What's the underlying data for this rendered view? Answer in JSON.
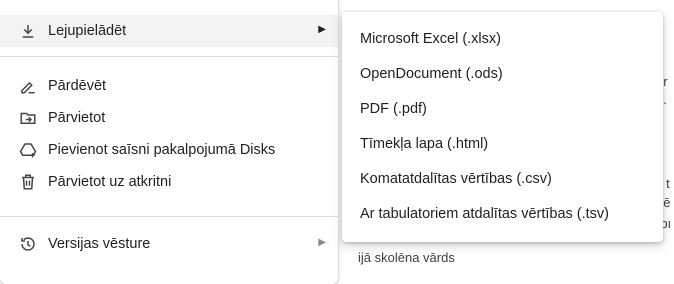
{
  "file_menu": {
    "download": {
      "label": "Lejupielādēt",
      "icon": "download-icon"
    },
    "rename": {
      "label": "Pārdēvēt",
      "icon": "rename-icon"
    },
    "move": {
      "label": "Pārvietot",
      "icon": "move-folder-icon"
    },
    "add_shortcut": {
      "label": "Pievienot saīsni pakalpojumā Disks",
      "icon": "add-shortcut-drive-icon"
    },
    "trash": {
      "label": "Pārvietot uz atkritni",
      "icon": "trash-icon"
    },
    "version_history": {
      "label": "Versijas vēsture",
      "icon": "history-icon"
    }
  },
  "download_submenu": {
    "items": [
      {
        "label": "Microsoft Excel (.xlsx)"
      },
      {
        "label": "OpenDocument (.ods)"
      },
      {
        "label": "PDF (.pdf)"
      },
      {
        "label": "Tīmekļa lapa (.html)"
      },
      {
        "label": "Komatatdalītas vērtības (.csv)"
      },
      {
        "label": "Ar tabulatoriem atdalītas vērtības (.tsv)"
      }
    ]
  },
  "background_fragments": [
    "or",
    "ē.",
    "s t",
    "dē",
    "rbı",
    "ijā skolēna vārds"
  ],
  "colors": {
    "menu_bg": "#ffffff",
    "highlight": "#f1f3f4",
    "separator": "#dadce0",
    "text": "#1f1f1f"
  }
}
